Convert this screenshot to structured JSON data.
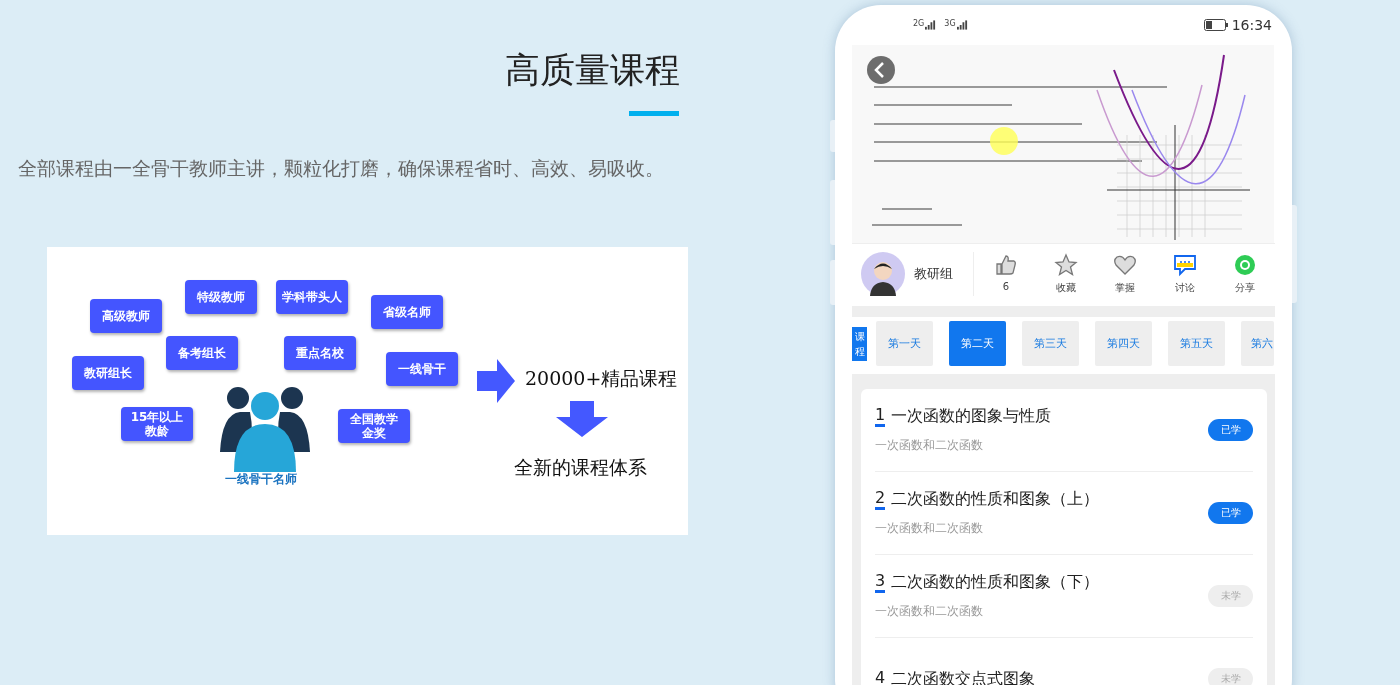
{
  "hero": {
    "title": "高质量课程",
    "description": "全部课程由一全骨干教师主讲，颗粒化打磨，确保课程省时、高效、易吸收。"
  },
  "diagram": {
    "tags": [
      "高级教师",
      "特级教师",
      "学科带头人",
      "省级名师",
      "教研组长",
      "备考组长",
      "重点名校",
      "一线骨干",
      "15年以上教龄",
      "全国教学金奖"
    ],
    "caption": "一线骨干名师",
    "result": "20000+精品课程",
    "outcome": "全新的课程体系"
  },
  "phone": {
    "status": {
      "networks": [
        "2G",
        "3G"
      ],
      "time": "16:34"
    },
    "teacher": {
      "name": "教研组"
    },
    "actions": [
      {
        "kind": "like",
        "label": "6"
      },
      {
        "kind": "favorite",
        "label": "收藏"
      },
      {
        "kind": "master",
        "label": "掌握"
      },
      {
        "kind": "discuss",
        "label": "讨论"
      },
      {
        "kind": "share",
        "label": "分享"
      }
    ],
    "course_label": "课程",
    "days": [
      {
        "label": "第一天",
        "selected": false
      },
      {
        "label": "第二天",
        "selected": true
      },
      {
        "label": "第三天",
        "selected": false
      },
      {
        "label": "第四天",
        "selected": false
      },
      {
        "label": "第五天",
        "selected": false
      },
      {
        "label": "第六",
        "selected": false
      }
    ],
    "lessons": [
      {
        "number": "1",
        "title": "一次函数的图象与性质",
        "subtitle": "一次函数和二次函数",
        "status": "已学",
        "studied": true
      },
      {
        "number": "2",
        "title": "二次函数的性质和图象（上）",
        "subtitle": "一次函数和二次函数",
        "status": "已学",
        "studied": true
      },
      {
        "number": "3",
        "title": "二次函数的性质和图象（下）",
        "subtitle": "一次函数和二次函数",
        "status": "未学",
        "studied": false
      },
      {
        "number": "4",
        "title": "二次函数交点式图象",
        "status": "未学",
        "studied": false
      }
    ]
  }
}
